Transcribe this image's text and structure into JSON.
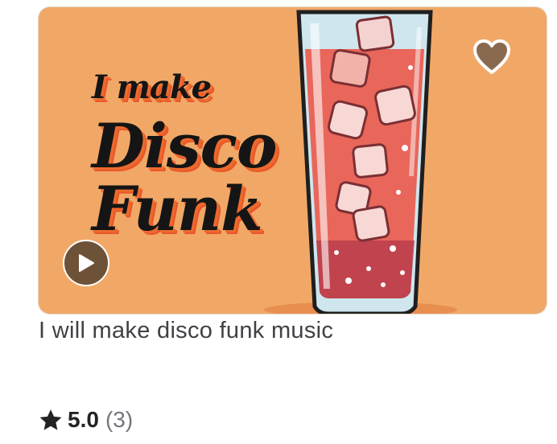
{
  "gig": {
    "thumbnail": {
      "line1": "I make",
      "line2": "Disco",
      "line3": "Funk",
      "background_color": "#f1a867",
      "heart_color": "#8a6a4e",
      "play_color": "#6e5238"
    },
    "title": "I will make disco funk music",
    "rating": {
      "score": "5.0",
      "count": "(3)"
    }
  },
  "icons": {
    "favorite": "heart-icon",
    "play": "play-icon",
    "rating": "star-icon"
  }
}
